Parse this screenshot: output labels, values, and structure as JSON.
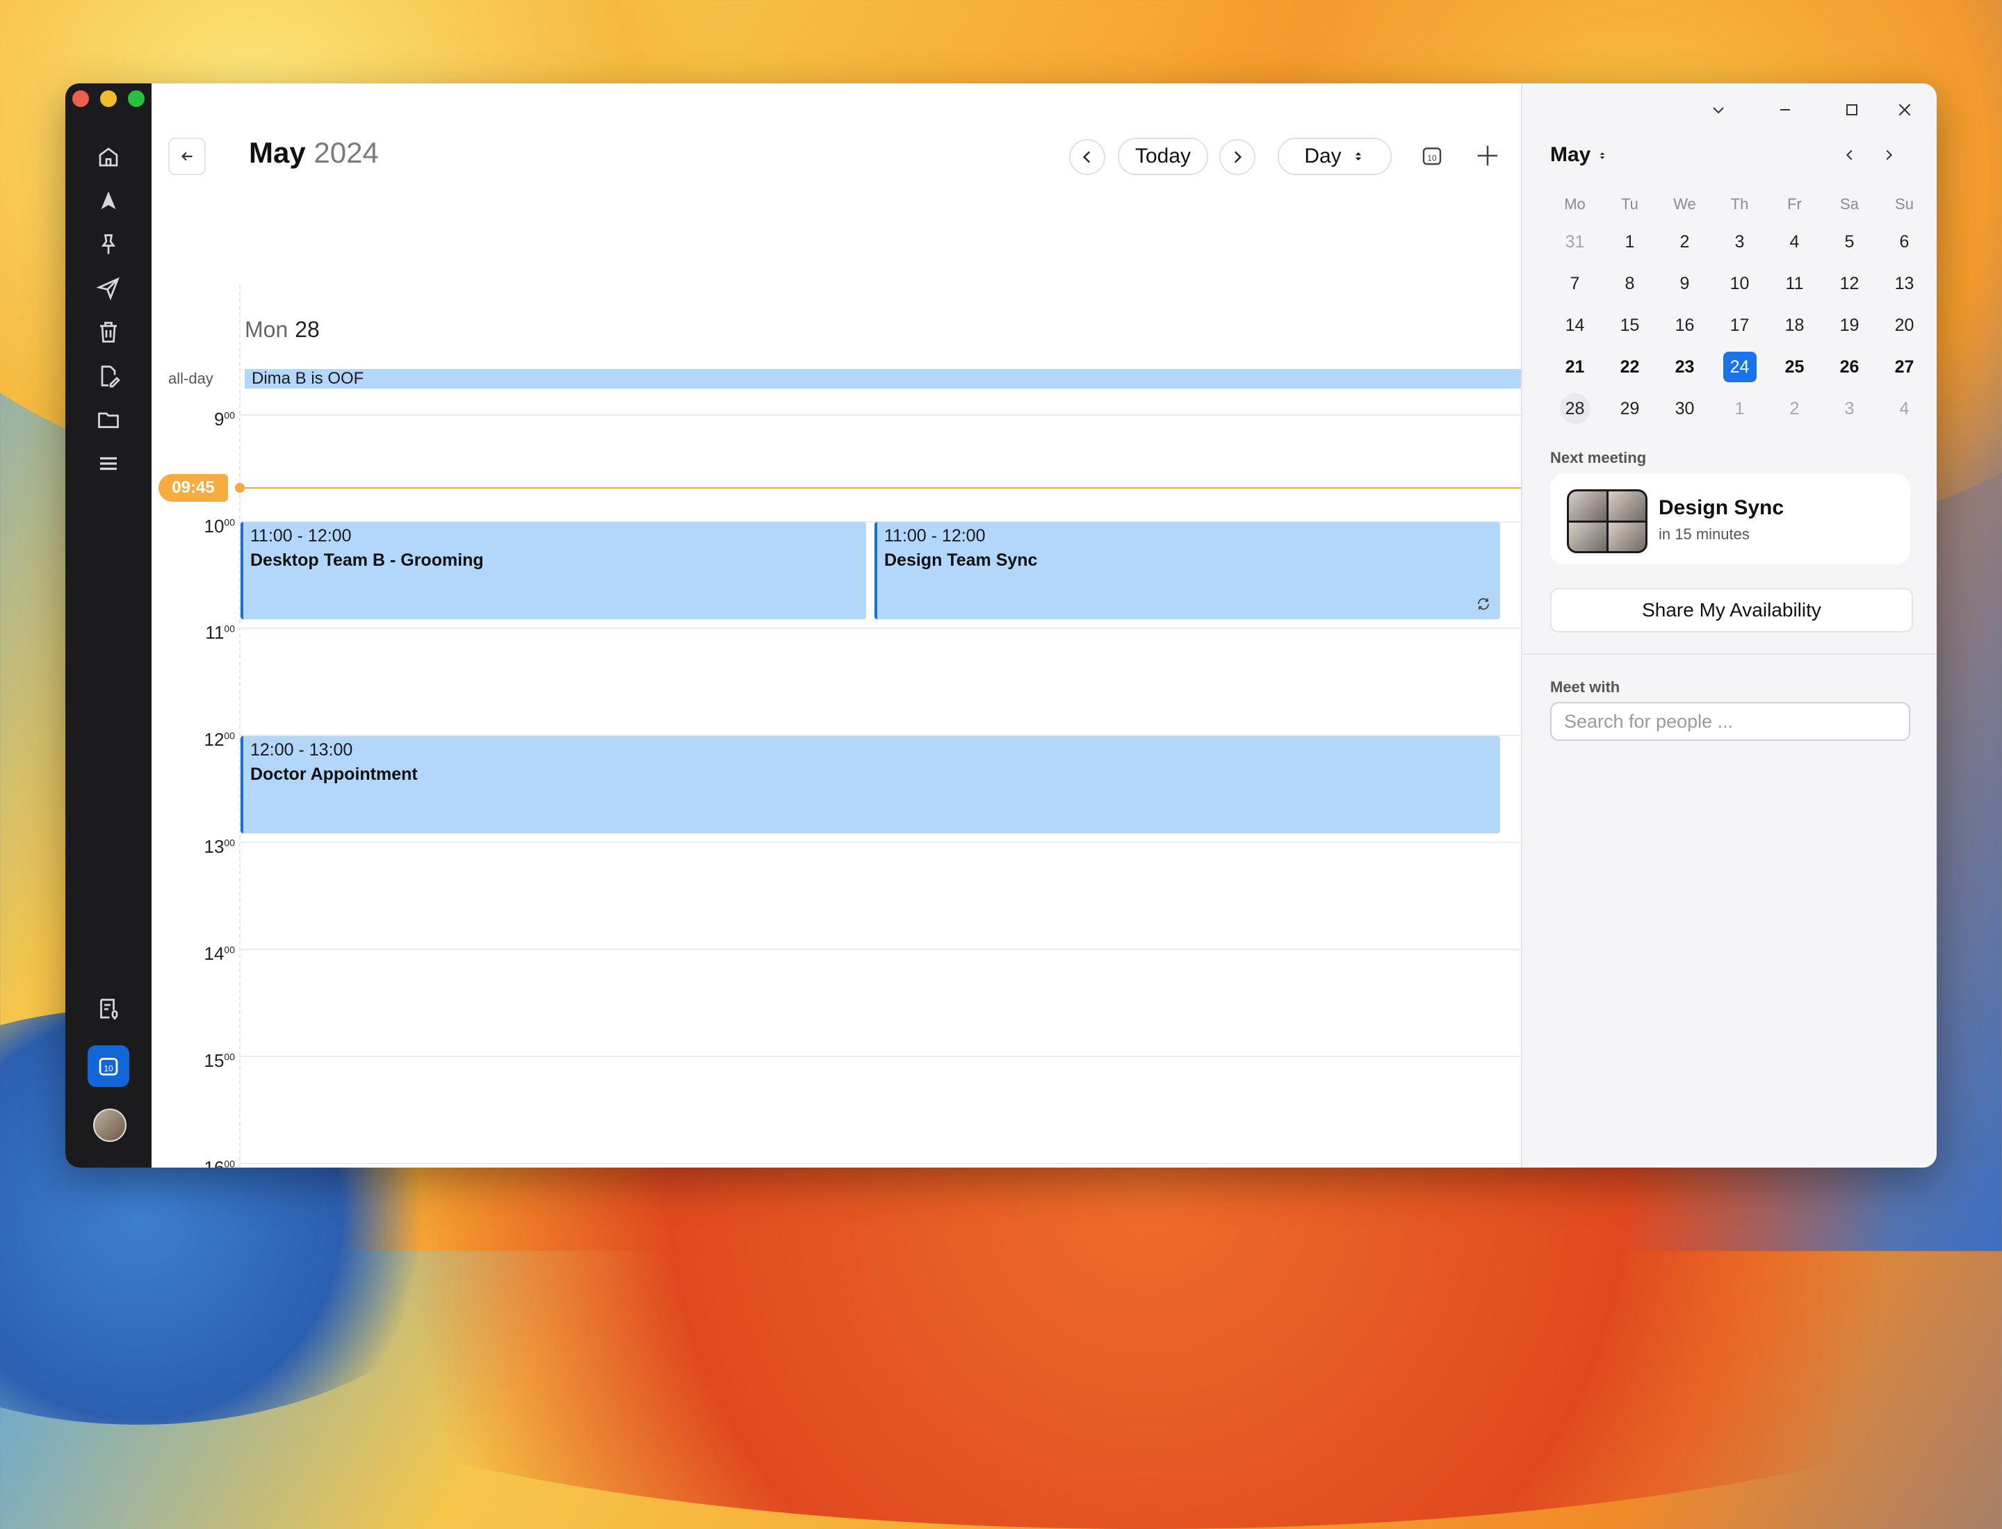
{
  "header": {
    "month": "May",
    "year": "2024",
    "today_label": "Today",
    "view_label": "Day"
  },
  "day": {
    "weekday": "Mon",
    "date": "28",
    "allday_label": "all-day",
    "allday_event": "Dima B is OOF"
  },
  "hours": [
    {
      "h": "9",
      "m": "00"
    },
    {
      "h": "10",
      "m": "00"
    },
    {
      "h": "11",
      "m": "00"
    },
    {
      "h": "12",
      "m": "00"
    },
    {
      "h": "13",
      "m": "00"
    },
    {
      "h": "14",
      "m": "00"
    },
    {
      "h": "15",
      "m": "00"
    },
    {
      "h": "16",
      "m": "00"
    }
  ],
  "now": "09:45",
  "events": [
    {
      "time": "11:00 - 12:00",
      "title": "Desktop Team B - Grooming"
    },
    {
      "time": "11:00 - 12:00",
      "title": "Design Team Sync"
    },
    {
      "time": "12:00 - 13:00",
      "title": "Doctor Appointment"
    }
  ],
  "mini_calendar": {
    "title": "May",
    "weekdays": [
      "Mo",
      "Tu",
      "We",
      "Th",
      "Fr",
      "Sa",
      "Su"
    ],
    "weeks": [
      [
        "31",
        "1",
        "2",
        "3",
        "4",
        "5",
        "6"
      ],
      [
        "7",
        "8",
        "9",
        "10",
        "11",
        "12",
        "13"
      ],
      [
        "14",
        "15",
        "16",
        "17",
        "18",
        "19",
        "20"
      ],
      [
        "21",
        "22",
        "23",
        "24",
        "25",
        "26",
        "27"
      ],
      [
        "28",
        "29",
        "30",
        "1",
        "2",
        "3",
        "4"
      ]
    ],
    "selected": "24",
    "current": "28"
  },
  "next_meeting": {
    "label": "Next meeting",
    "title": "Design Sync",
    "subtitle": "in 15 minutes"
  },
  "share_label": "Share My Availability",
  "meet_with": {
    "label": "Meet with",
    "placeholder": "Search for people ..."
  },
  "colors": {
    "accent": "#1a73e8",
    "event_bg": "#b3d7fb",
    "event_border": "#1c6fd2",
    "now_line": "#f5a83c",
    "rail_bg": "#1b1b1d"
  }
}
